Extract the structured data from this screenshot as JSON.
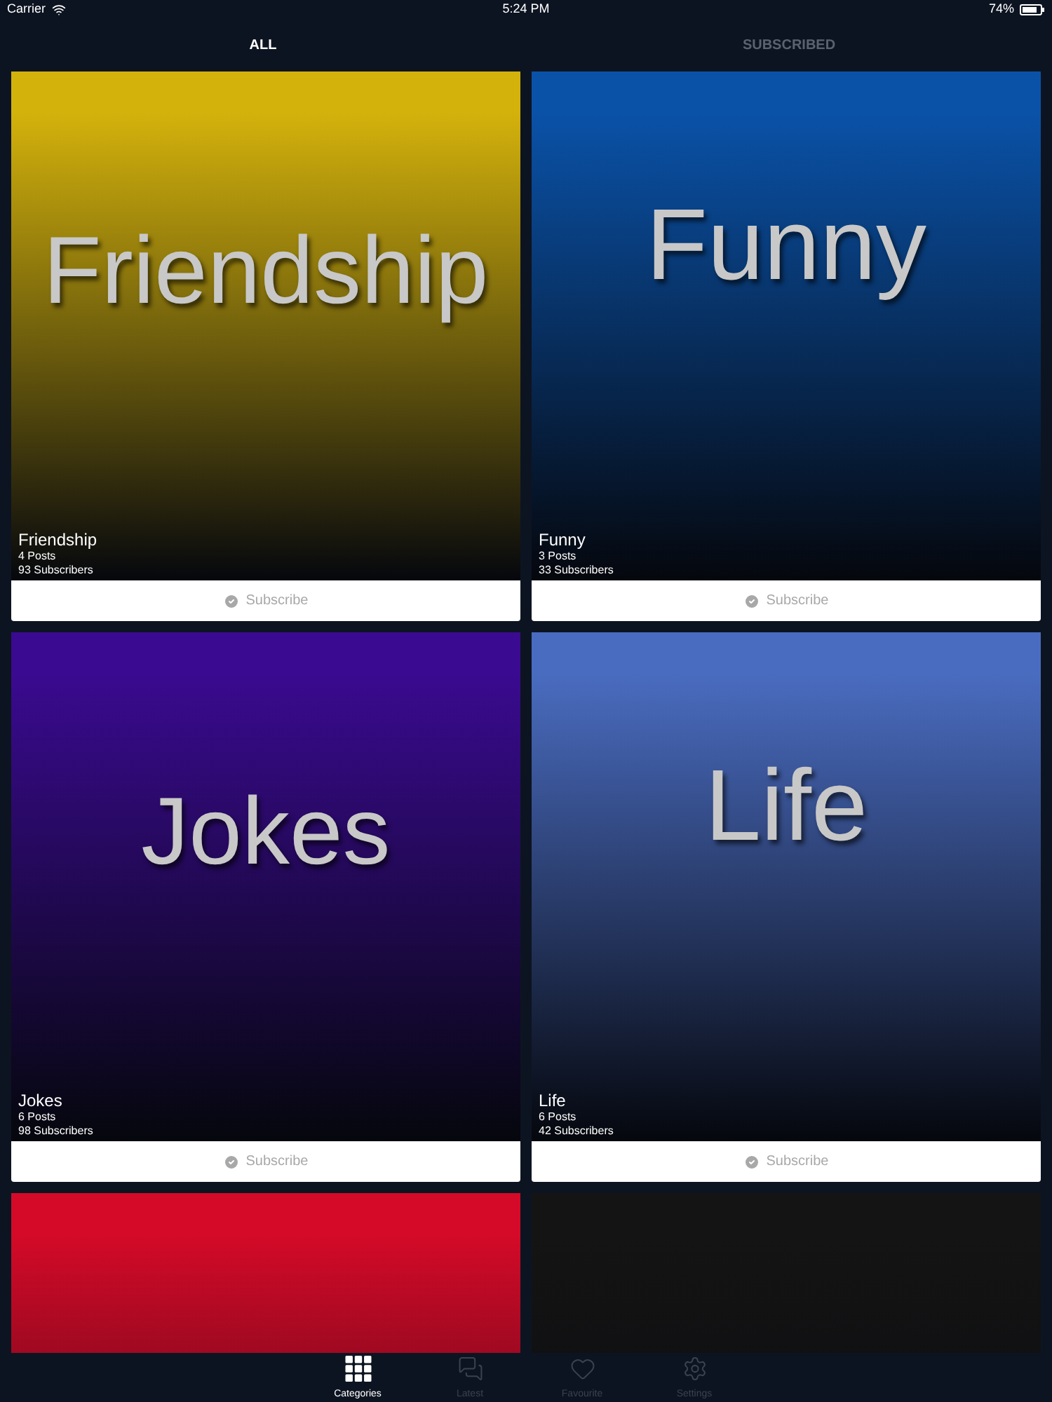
{
  "status_bar": {
    "carrier": "Carrier",
    "time": "5:24 PM",
    "battery": "74%"
  },
  "tabs": [
    {
      "label": "ALL",
      "selected": true
    },
    {
      "label": "SUBSCRIBED",
      "selected": false
    }
  ],
  "categories": [
    {
      "cover_text": "Friendship",
      "color": "#d4b20c",
      "name": "Friendship",
      "posts": "4 Posts",
      "subscribers": "93 Subscribers",
      "button": "Subscribe"
    },
    {
      "cover_text": "Funny",
      "color": "#0a52a8",
      "name": "Funny",
      "posts": "3 Posts",
      "subscribers": "33 Subscribers",
      "button": "Subscribe"
    },
    {
      "cover_text": "Jokes",
      "color": "#3a0a90",
      "name": "Jokes",
      "posts": "6 Posts",
      "subscribers": "98 Subscribers",
      "button": "Subscribe"
    },
    {
      "cover_text": "Life",
      "color": "#4a6cc0",
      "name": "Life",
      "posts": "6 Posts",
      "subscribers": "42 Subscribers",
      "button": "Subscribe"
    },
    {
      "color": "#d40a28"
    },
    {
      "color": "#141414"
    }
  ],
  "bottom_tabs": [
    {
      "kind": "grid",
      "label": "Categories",
      "selected": true
    },
    {
      "kind": "chat",
      "label": "Latest",
      "selected": false
    },
    {
      "kind": "heart",
      "label": "Favourite",
      "selected": false
    },
    {
      "kind": "gear",
      "label": "Settings",
      "selected": false
    }
  ]
}
